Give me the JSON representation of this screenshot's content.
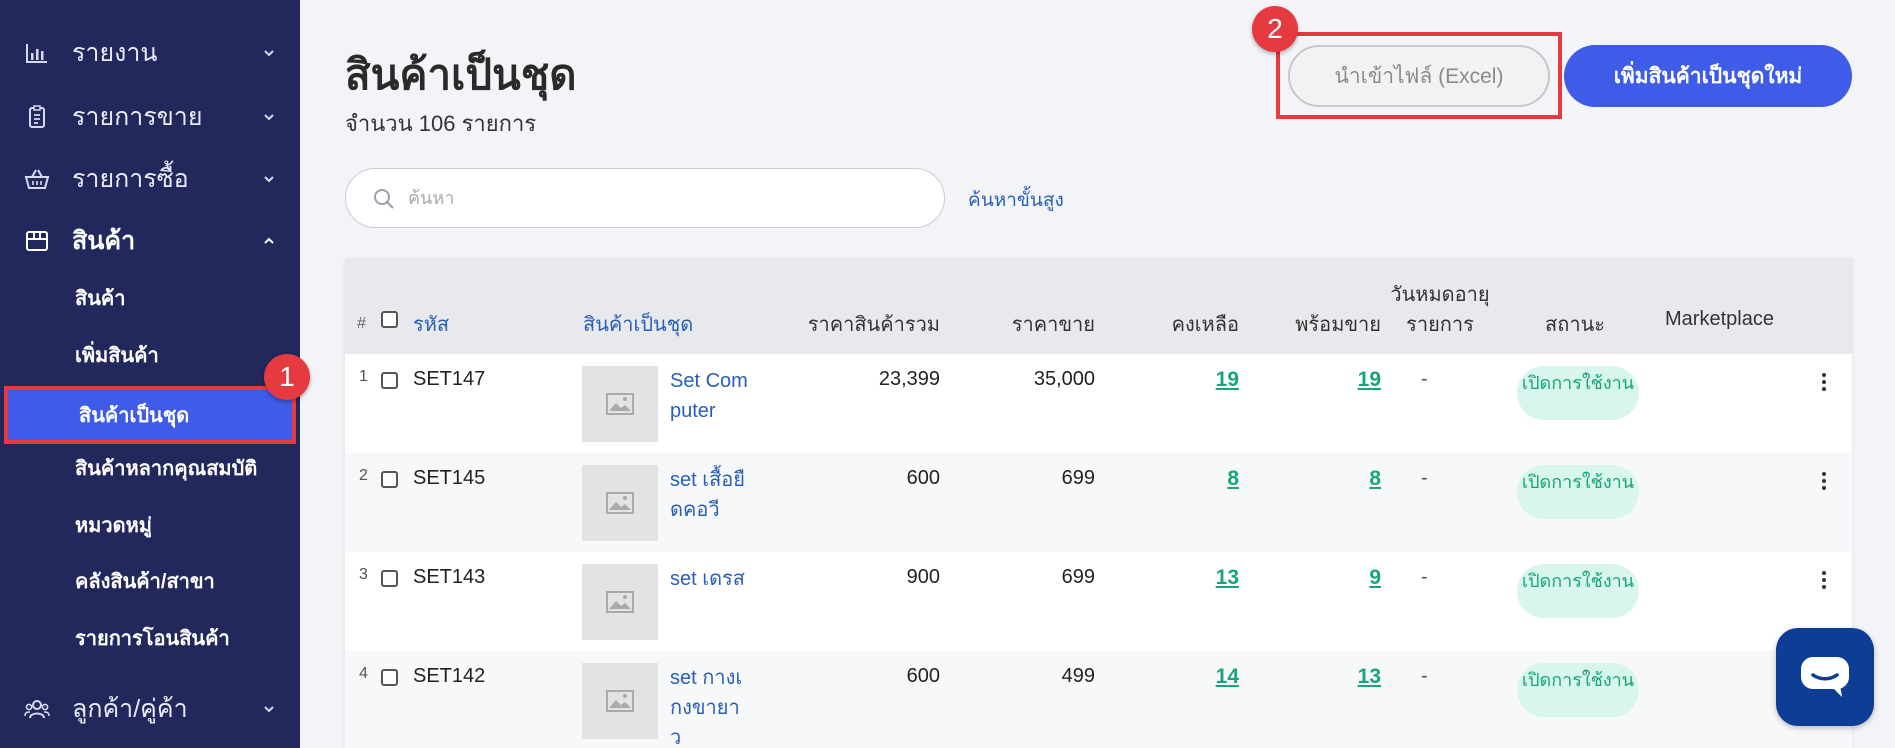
{
  "sidebar": {
    "groups": [
      {
        "label": "รายงาน",
        "icon": "bar-chart-icon"
      },
      {
        "label": "รายการขาย",
        "icon": "clipboard-icon"
      },
      {
        "label": "รายการซื้อ",
        "icon": "basket-icon"
      },
      {
        "label": "สินค้า",
        "icon": "box-icon"
      },
      {
        "label": "ลูกค้า/คู่ค้า",
        "icon": "users-icon"
      }
    ],
    "product_items": [
      {
        "label": "สินค้า"
      },
      {
        "label": "เพิ่มสินค้า"
      },
      {
        "label": "สินค้าเป็นชุด"
      },
      {
        "label": "สินค้าหลากคุณสมบัติ"
      },
      {
        "label": "หมวดหมู่"
      },
      {
        "label": "คลังสินค้า/สาขา"
      },
      {
        "label": "รายการโอนสินค้า"
      }
    ],
    "active_item": "สินค้าเป็นชุด"
  },
  "badges": {
    "one": "1",
    "two": "2"
  },
  "header": {
    "title": "สินค้าเป็นชุด",
    "subtitle": "จำนวน 106 รายการ",
    "import_label": "นำเข้าไฟล์ (Excel)",
    "add_label": "เพิ่มสินค้าเป็นชุดใหม่"
  },
  "search": {
    "placeholder": "ค้นหา",
    "advanced_label": "ค้นหาขั้นสูง"
  },
  "table": {
    "columns": {
      "num": "#",
      "code": "รหัส",
      "product_set": "สินค้าเป็นชุด",
      "total_price": "ราคาสินค้ารวม",
      "sale_price": "ราคาขาย",
      "remaining": "คงเหลือ",
      "ready": "พร้อมขาย",
      "expiry_line1": "วันหมดอายุ",
      "expiry_line2": "รายการ",
      "status": "สถานะ",
      "marketplace": "Marketplace"
    },
    "rows": [
      {
        "num": "1",
        "code": "SET147",
        "name": "Set Computer",
        "total": "23,399",
        "price": "35,000",
        "remaining": "19",
        "ready": "19",
        "expiry": "-",
        "status": "เปิดการใช้งาน"
      },
      {
        "num": "2",
        "code": "SET145",
        "name": "set เสื้อยืดคอวี",
        "total": "600",
        "price": "699",
        "remaining": "8",
        "ready": "8",
        "expiry": "-",
        "status": "เปิดการใช้งาน"
      },
      {
        "num": "3",
        "code": "SET143",
        "name": "set เดรส",
        "total": "900",
        "price": "699",
        "remaining": "13",
        "ready": "9",
        "expiry": "-",
        "status": "เปิดการใช้งาน"
      },
      {
        "num": "4",
        "code": "SET142",
        "name": "set กางเกงขายาว",
        "total": "600",
        "price": "499",
        "remaining": "14",
        "ready": "13",
        "expiry": "-",
        "status": "เปิดการใช้งาน"
      }
    ]
  },
  "colors": {
    "sidebar_bg": "#23285c",
    "accent_blue": "#3e5ce8",
    "highlight_red": "#e53a40",
    "status_green": "#17a67a"
  }
}
